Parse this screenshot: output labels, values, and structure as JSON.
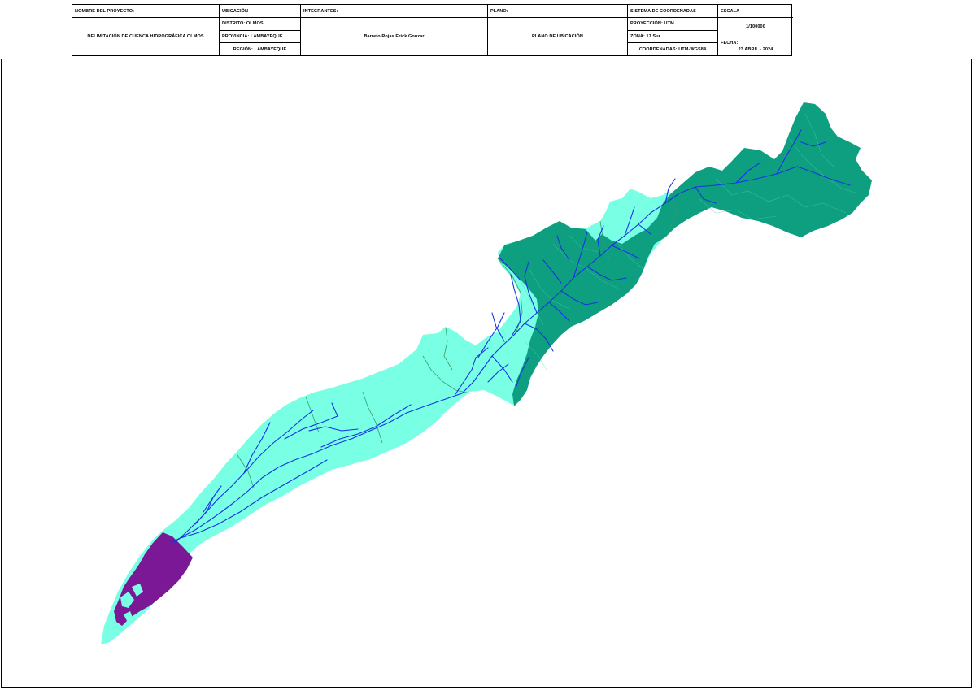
{
  "title_block": {
    "project_label": "NOMBRE DEL PROYECTO:",
    "project_name": "DELIMITACIÓN DE CUENCA HIDROGRÁFICA OLMOS",
    "location_label": "UBICACIÓN",
    "district": "DISTRITO: OLMOS",
    "province": "PROVINCIA: LAMBAYEQUE",
    "region": "REGIÓN: LAMBAYEQUE",
    "members_label": "INTEGRANTES:",
    "members": "Barreto Rojas Erick Gonzar",
    "plan_label": "PLANO:",
    "plan_name": "PLANO DE UBICACIÓN",
    "coord_system_label": "SISTEMA DE COORDENADAS",
    "projection": "PROYECCIÓN: UTM",
    "zone": "ZONA: 17 Sur",
    "coordinates": "COORDENADAS: UTM-WGS84",
    "scale_label": "ESCALA",
    "scale": "1/100000",
    "date_label": "FECHA:",
    "date": "23 ABRIL - 2024"
  },
  "map": {
    "colors": {
      "lower_basin": "#79ffe3",
      "upper_basin": "#0e9e80",
      "outlet_zone": "#7a1896",
      "rivers": "#1533e6",
      "subbasin_lines": "#3a9a6a",
      "frame": "#000000"
    }
  }
}
